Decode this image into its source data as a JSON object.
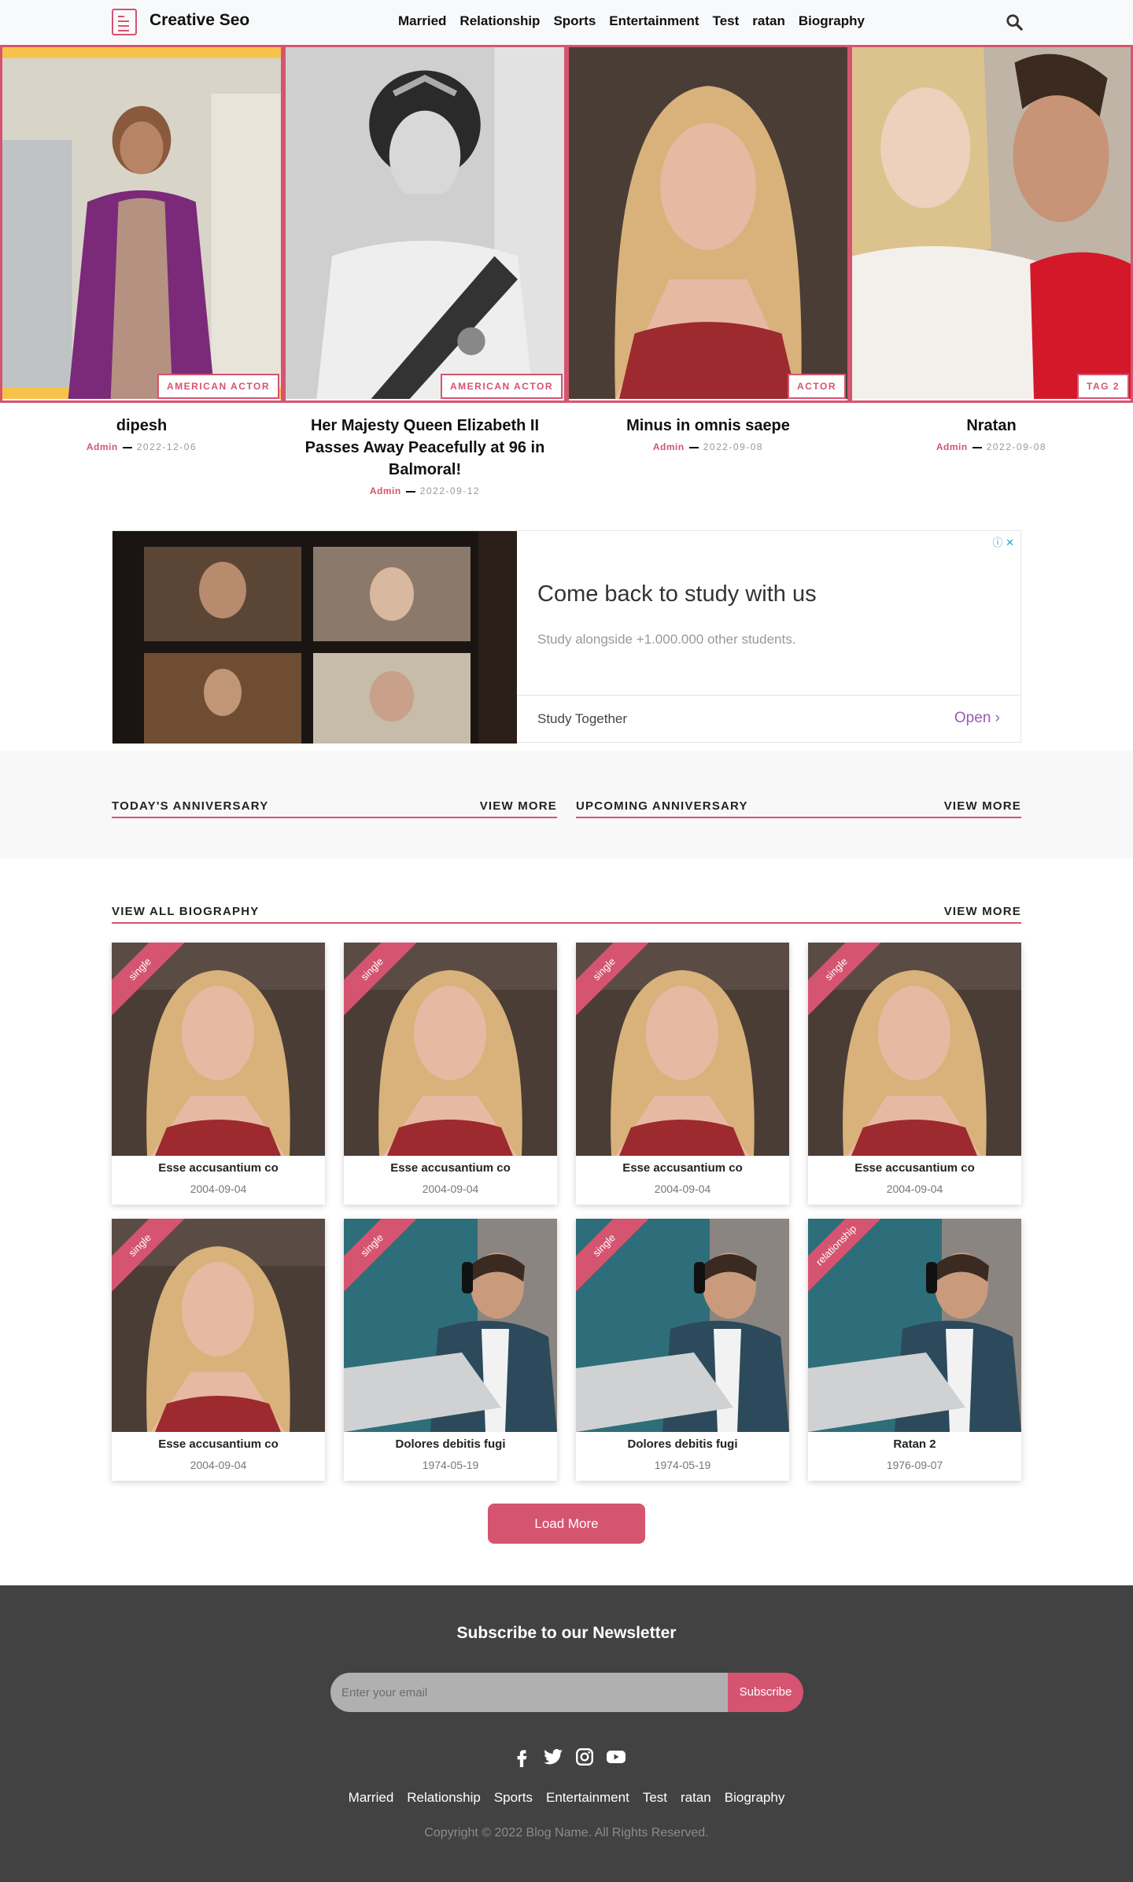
{
  "header": {
    "brand": "Creative Seo",
    "nav": [
      "Married",
      "Relationship",
      "Sports",
      "Entertainment",
      "Test",
      "ratan",
      "Biography"
    ]
  },
  "hero": [
    {
      "tag": "AMERICAN ACTOR",
      "title": "dipesh",
      "author": "Admin",
      "date": "2022-12-06"
    },
    {
      "tag": "AMERICAN ACTOR",
      "title": "Her Majesty Queen Elizabeth II Passes Away Peacefully at 96 in Balmoral!",
      "author": "Admin",
      "date": "2022-09-12"
    },
    {
      "tag": "ACTOR",
      "title": "Minus in omnis saepe",
      "author": "Admin",
      "date": "2022-09-08"
    },
    {
      "tag": "TAG 2",
      "title": "Nratan",
      "author": "Admin",
      "date": "2022-09-08"
    }
  ],
  "ad": {
    "title": "Come back to study with us",
    "subtitle": "Study alongside +1.000.000 other students.",
    "brand": "Study Together",
    "cta": "Open"
  },
  "anniversary": {
    "today_title": "TODAY'S ANNIVERSARY",
    "upcoming_title": "UPCOMING ANNIVERSARY",
    "view_more": "VIEW MORE"
  },
  "biography": {
    "title": "VIEW ALL BIOGRAPHY",
    "view_more": "VIEW MORE",
    "items": [
      {
        "ribbon": "single",
        "name": "Esse accusantium co",
        "date": "2004-09-04",
        "photo": "woman"
      },
      {
        "ribbon": "single",
        "name": "Esse accusantium co",
        "date": "2004-09-04",
        "photo": "woman"
      },
      {
        "ribbon": "single",
        "name": "Esse accusantium co",
        "date": "2004-09-04",
        "photo": "woman"
      },
      {
        "ribbon": "single",
        "name": "Esse accusantium co",
        "date": "2004-09-04",
        "photo": "woman"
      },
      {
        "ribbon": "single",
        "name": "Esse accusantium co",
        "date": "2004-09-04",
        "photo": "woman"
      },
      {
        "ribbon": "single",
        "name": "Dolores debitis fugi",
        "date": "1974-05-19",
        "photo": "man"
      },
      {
        "ribbon": "single",
        "name": "Dolores debitis fugi",
        "date": "1974-05-19",
        "photo": "man"
      },
      {
        "ribbon": "relationship",
        "name": "Ratan 2",
        "date": "1976-09-07",
        "photo": "man"
      }
    ],
    "load_more": "Load More"
  },
  "footer": {
    "newsletter_title": "Subscribe to our Newsletter",
    "email_placeholder": "Enter your email",
    "subscribe": "Subscribe",
    "social_icons": [
      "facebook-icon",
      "twitter-icon",
      "instagram-icon",
      "youtube-icon"
    ],
    "nav": [
      "Married",
      "Relationship",
      "Sports",
      "Entertainment",
      "Test",
      "ratan",
      "Biography"
    ],
    "copyright": "Copyright © 2022 Blog Name. All Rights Reserved."
  },
  "colors": {
    "accent": "#d5546f",
    "footer_bg": "#424242",
    "header_bg": "#f8f9fa"
  }
}
